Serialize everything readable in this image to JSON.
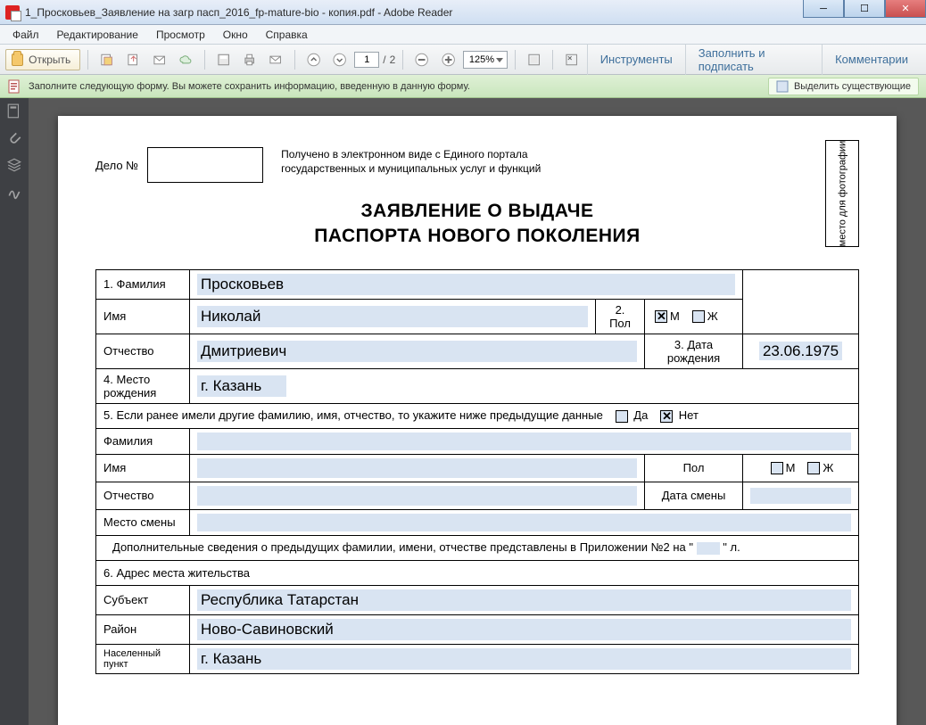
{
  "window": {
    "title": "1_Просковьев_Заявление на загр пасп_2016_fp-mature-bio - копия.pdf - Adobe Reader"
  },
  "menu": {
    "file": "Файл",
    "edit": "Редактирование",
    "view": "Просмотр",
    "window": "Окно",
    "help": "Справка"
  },
  "toolbar": {
    "open": "Открыть",
    "page_current": "1",
    "page_sep": "/",
    "page_total": "2",
    "zoom": "125%",
    "tools": "Инструменты",
    "fillsign": "Заполнить и подписать",
    "comment": "Комментарии"
  },
  "infobar": {
    "text": "Заполните следующую форму. Вы можете сохранить информацию, введенную в данную форму.",
    "highlight": "Выделить существующие"
  },
  "doc": {
    "delo_label": "Дело №",
    "portal": "Получено в электронном виде с Единого портала государственных и муниципальных услуг и функций",
    "photo": "место для фотографии",
    "title1": "ЗАЯВЛЕНИЕ О ВЫДАЧЕ",
    "title2": "ПАСПОРТА НОВОГО ПОКОЛЕНИЯ",
    "r1_label": "1. Фамилия",
    "surname": "Просковьев",
    "name_label": "Имя",
    "name": "Николай",
    "gender_label": "2. Пол",
    "gender_m": "М",
    "gender_f": "Ж",
    "patr_label": "Отчество",
    "patr": "Дмитриевич",
    "dob_label": "3. Дата рождения",
    "dob": "23.06.1975",
    "pob_label": "4. Место рождения",
    "pob": "г. Казань",
    "prev_q": "5. Если ранее имели другие фамилию, имя, отчество, то укажите ниже предыдущие данные",
    "yes": "Да",
    "no": "Нет",
    "prev_surname_label": "Фамилия",
    "prev_name_label": "Имя",
    "prev_gender_label": "Пол",
    "prev_patr_label": "Отчество",
    "change_date_label": "Дата смены",
    "change_place_label": "Место смены",
    "appendix_pre": "Дополнительные сведения о предыдущих фамилии, имени, отчестве представлены в Приложении №2 на \"",
    "appendix_post": "\" л.",
    "addr_label": "6. Адрес места жительства",
    "subj_label": "Субъект",
    "subj": "Республика Татарстан",
    "raion_label": "Район",
    "raion": "Ново-Савиновский",
    "city_label": "Населенный пункт",
    "city": "г. Казань"
  }
}
